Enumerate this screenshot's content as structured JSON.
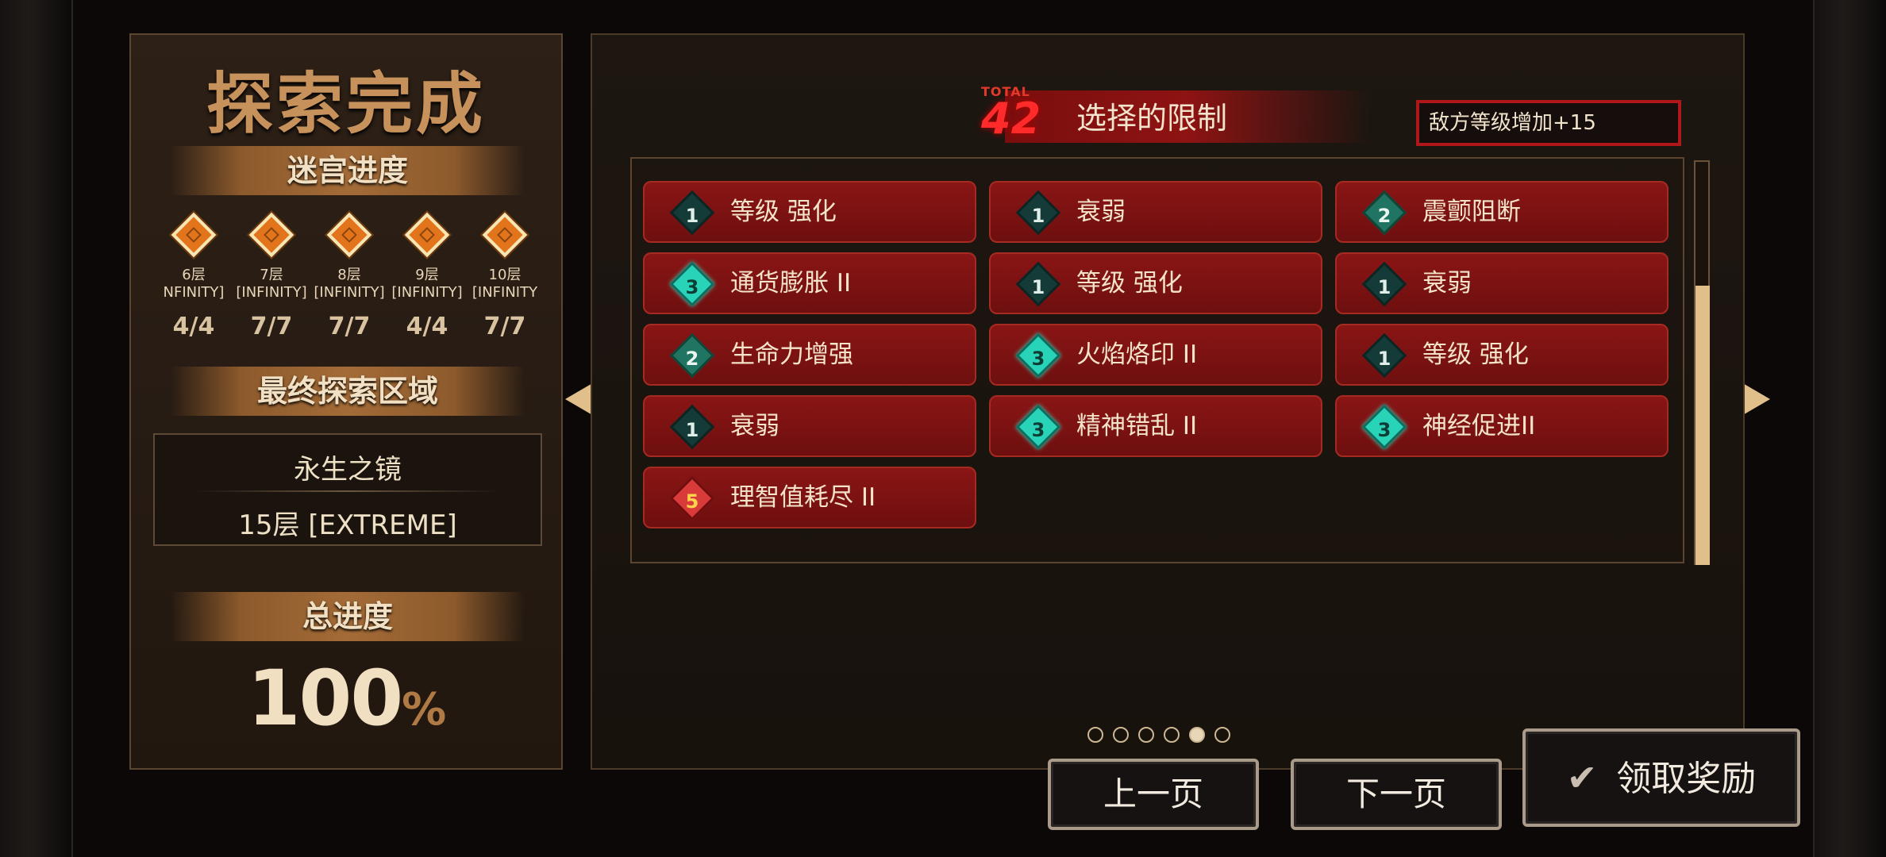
{
  "left_panel": {
    "title": "探索完成",
    "maze_progress_label": "迷宫进度",
    "floors": [
      {
        "name": "6层",
        "mode": "NFINITY]",
        "count": "4/4"
      },
      {
        "name": "7层",
        "mode": "[INFINITY]",
        "count": "7/7"
      },
      {
        "name": "8层",
        "mode": "[INFINITY]",
        "count": "7/7"
      },
      {
        "name": "9层",
        "mode": "[INFINITY]",
        "count": "4/4"
      },
      {
        "name": "10层",
        "mode": "[INFINITY",
        "count": "7/7"
      }
    ],
    "final_area_label": "最终探索区域",
    "final_area_name": "永生之镜",
    "final_area_floor": "15层 [EXTREME]",
    "total_progress_label": "总进度",
    "total_progress_value": "100",
    "total_progress_unit": "%"
  },
  "right_panel": {
    "total_label": "TOTAL",
    "total_value": "42",
    "header_title": "选择的限制",
    "tooltip": "敌方等级增加+15",
    "restrictions": [
      {
        "level": "1",
        "label": "等级 强化"
      },
      {
        "level": "1",
        "label": "衰弱"
      },
      {
        "level": "2",
        "label": "震颤阻断"
      },
      {
        "level": "3",
        "label": "通货膨胀 II"
      },
      {
        "level": "1",
        "label": "等级 强化"
      },
      {
        "level": "1",
        "label": "衰弱"
      },
      {
        "level": "2",
        "label": "生命力增强"
      },
      {
        "level": "3",
        "label": "火焰烙印 II"
      },
      {
        "level": "1",
        "label": "等级 强化"
      },
      {
        "level": "1",
        "label": "衰弱"
      },
      {
        "level": "3",
        "label": "精神错乱 II"
      },
      {
        "level": "3",
        "label": "神经促进II"
      },
      {
        "level": "5",
        "label": "理智值耗尽 II"
      }
    ],
    "scroll_position": 0.45,
    "page_count": 6,
    "active_page": 5
  },
  "buttons": {
    "prev": "上一页",
    "next": "下一页",
    "claim": "领取奖励"
  },
  "colors": {
    "accent": "#c7915c",
    "restriction_red": "#8a1515",
    "level_teal": "#29d3b7",
    "level_dark": "#153b38",
    "level_red": "#d93a3a"
  },
  "icons": {
    "floor": "orange-diamond-seal-icon",
    "claim": "check-icon",
    "nav_left": "triangle-left-icon",
    "nav_right": "triangle-right-icon"
  }
}
